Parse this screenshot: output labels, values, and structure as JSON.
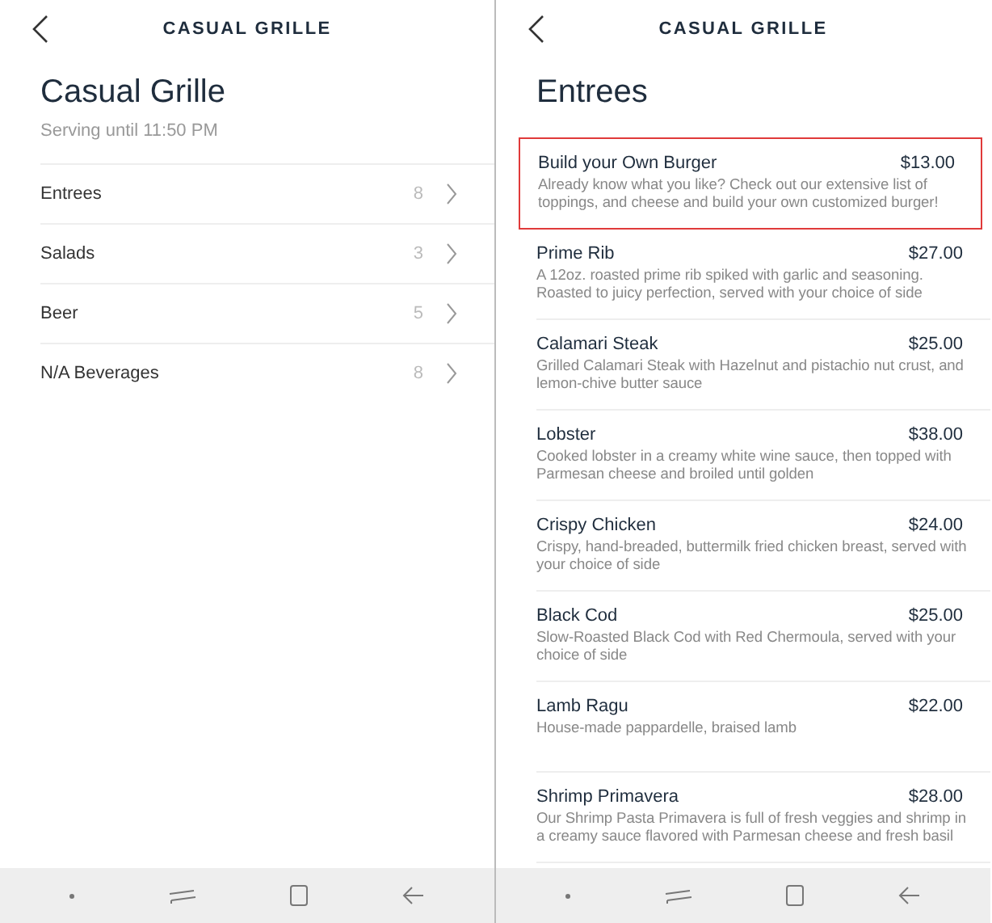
{
  "screens": [
    {
      "kind": "menu",
      "header": "CASUAL GRILLE",
      "title": "Casual Grille",
      "subtitle": "Serving until 11:50 PM",
      "categories": [
        {
          "name": "Entrees",
          "count": "8"
        },
        {
          "name": "Salads",
          "count": "3"
        },
        {
          "name": "Beer",
          "count": "5"
        },
        {
          "name": "N/A Beverages",
          "count": "8"
        }
      ]
    },
    {
      "kind": "items",
      "header": "CASUAL GRILLE",
      "title": "Entrees",
      "items": [
        {
          "name": "Build your Own Burger",
          "price": "$13.00",
          "description": "Already know what you like? Check out our extensive list of toppings, and cheese and build your own customized burger!",
          "highlighted": true
        },
        {
          "name": "Prime Rib",
          "price": "$27.00",
          "description": "A 12oz. roasted prime rib spiked with garlic and seasoning. Roasted to juicy perfection, served with your choice of side",
          "highlighted": false
        },
        {
          "name": "Calamari Steak",
          "price": "$25.00",
          "description": "Grilled Calamari Steak with Hazelnut and pistachio nut crust, and lemon-chive butter sauce",
          "highlighted": false
        },
        {
          "name": "Lobster",
          "price": "$38.00",
          "description": "Cooked lobster in a creamy white wine sauce, then topped with Parmesan cheese and broiled until golden",
          "highlighted": false
        },
        {
          "name": "Crispy Chicken",
          "price": "$24.00",
          "description": "Crispy, hand-breaded, buttermilk fried chicken breast, served with your choice of side",
          "highlighted": false
        },
        {
          "name": "Black Cod",
          "price": "$25.00",
          "description": "Slow-Roasted Black Cod with Red Chermoula, served with your choice of side",
          "highlighted": false
        },
        {
          "name": "Lamb Ragu",
          "price": "$22.00",
          "description": "House-made pappardelle, braised lamb",
          "highlighted": false
        },
        {
          "name": "Shrimp Primavera",
          "price": "$28.00",
          "description": "Our Shrimp Pasta Primavera is full of fresh veggies and shrimp in a creamy sauce flavored with Parmesan cheese and fresh basil",
          "highlighted": false
        }
      ]
    }
  ]
}
